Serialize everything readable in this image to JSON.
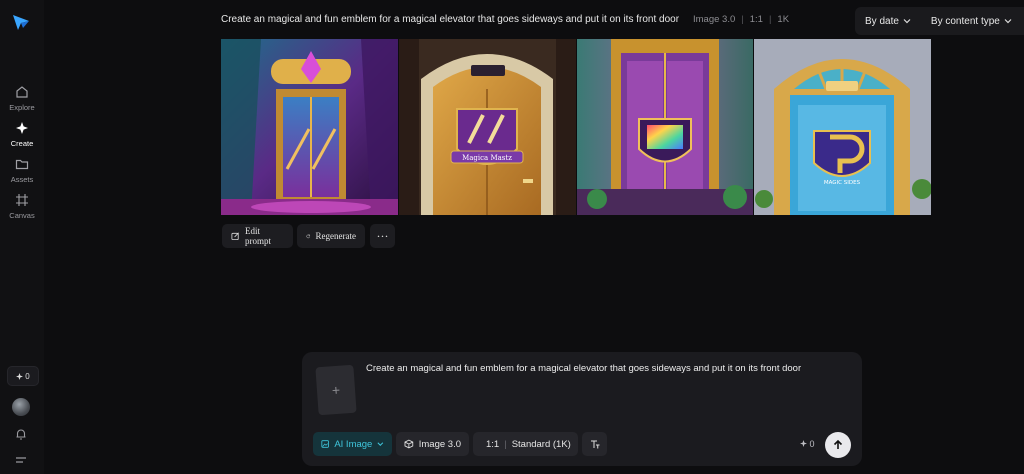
{
  "sidebar": {
    "nav": [
      {
        "label": "Explore",
        "icon": "home-icon"
      },
      {
        "label": "Create",
        "icon": "sparkle-icon"
      },
      {
        "label": "Assets",
        "icon": "folder-icon"
      },
      {
        "label": "Canvas",
        "icon": "canvas-icon"
      }
    ],
    "credits": "0"
  },
  "header": {
    "prompt": "Create an magical and fun emblem for a magical elevator that goes sideways and put it on its front door",
    "model": "Image 3.0",
    "ratio": "1:1",
    "resolution": "1K",
    "filters": [
      "By date",
      "By content type"
    ]
  },
  "images": [
    {
      "emblem_text": ""
    },
    {
      "emblem_text": "Magica Mastz"
    },
    {
      "emblem_text": ""
    },
    {
      "emblem_text": "MAGIC SIDES"
    }
  ],
  "actions": {
    "edit": "Edit prompt",
    "regenerate": "Regenerate",
    "more": "···"
  },
  "composer": {
    "text": "Create an magical and fun emblem for a magical elevator that goes sideways and put it on its front door",
    "upload_glyph": "+",
    "mode": "AI Image",
    "model": "Image 3.0",
    "ratio": "1:1",
    "quality": "Standard (1K)",
    "cost": "0"
  },
  "colors": {
    "accent": "#3fc6dc",
    "background": "#0d0d0f",
    "panel": "#1b1b1f"
  }
}
